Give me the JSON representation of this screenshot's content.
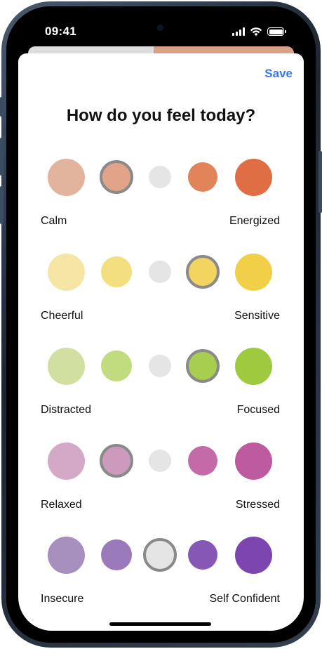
{
  "status_bar": {
    "time": "09:41"
  },
  "sheet": {
    "save_label": "Save",
    "title": "How do you feel today?"
  },
  "rows": [
    {
      "left_label": "Calm",
      "right_label": "Energized",
      "selected_index": 1,
      "colors": [
        "#e2b49e",
        "#e1a488",
        "#e5e5e5",
        "#e1845a",
        "#e06e44"
      ]
    },
    {
      "left_label": "Cheerful",
      "right_label": "Sensitive",
      "selected_index": 3,
      "colors": [
        "#f6e6a6",
        "#f4df80",
        "#e5e5e5",
        "#f2d45e",
        "#f2cf48"
      ]
    },
    {
      "left_label": "Distracted",
      "right_label": "Focused",
      "selected_index": 3,
      "colors": [
        "#d1e0a0",
        "#c1db7f",
        "#e5e5e5",
        "#a7ce4e",
        "#9fc93e"
      ]
    },
    {
      "left_label": "Relaxed",
      "right_label": "Stressed",
      "selected_index": 1,
      "colors": [
        "#d3a9c6",
        "#cb9abc",
        "#e5e5e5",
        "#c46aa9",
        "#bd5aa0"
      ]
    },
    {
      "left_label": "Insecure",
      "right_label": "Self Confident",
      "selected_index": 2,
      "colors": [
        "#a890be",
        "#9b7abb",
        "#e5e5e5",
        "#8757b6",
        "#7c45b0"
      ]
    }
  ],
  "theme": {
    "accent": "#3478f6",
    "selected_ring": "#8a8a8a"
  }
}
